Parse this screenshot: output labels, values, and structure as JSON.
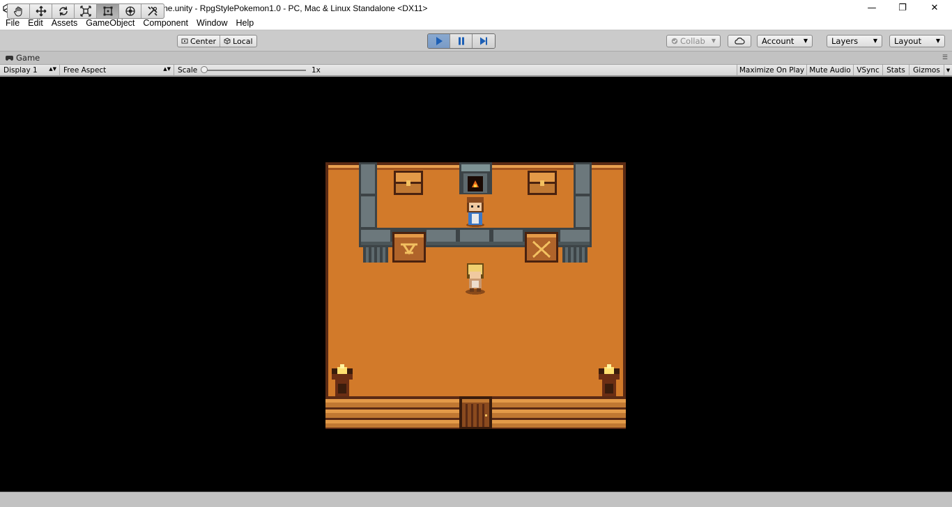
{
  "window": {
    "title": "Unity 2019.1.8f1 Personal - SampleScene.unity - RpgStylePokemon1.0 - PC, Mac & Linux Standalone <DX11>",
    "minimize": "—",
    "maximize": "❐",
    "close": "✕"
  },
  "menu": [
    "File",
    "Edit",
    "Assets",
    "GameObject",
    "Component",
    "Window",
    "Help"
  ],
  "toolbar": {
    "tools": [
      "hand-tool",
      "move-tool",
      "rotate-tool",
      "scale-tool",
      "rect-tool",
      "transform-tool",
      "custom-tool"
    ],
    "active_tool": "rect-tool",
    "pivot_center": "Center",
    "pivot_local": "Local",
    "play_state": "playing",
    "collab": "Collab",
    "account": "Account",
    "layers": "Layers",
    "layout": "Layout"
  },
  "game_tab": {
    "label": "Game"
  },
  "game_bar": {
    "display": "Display 1",
    "aspect": "Free Aspect",
    "scale_label": "Scale",
    "scale_value": "1x",
    "maximize_on_play": "Maximize On Play",
    "mute_audio": "Mute Audio",
    "vsync": "VSync",
    "stats": "Stats",
    "gizmos": "Gizmos"
  },
  "colors": {
    "floor": "#d27a2a",
    "wall_trim": "#e8a050",
    "stone": "#5e6a6e",
    "chest": "#c07832",
    "play_active": "#7a9bc6"
  }
}
